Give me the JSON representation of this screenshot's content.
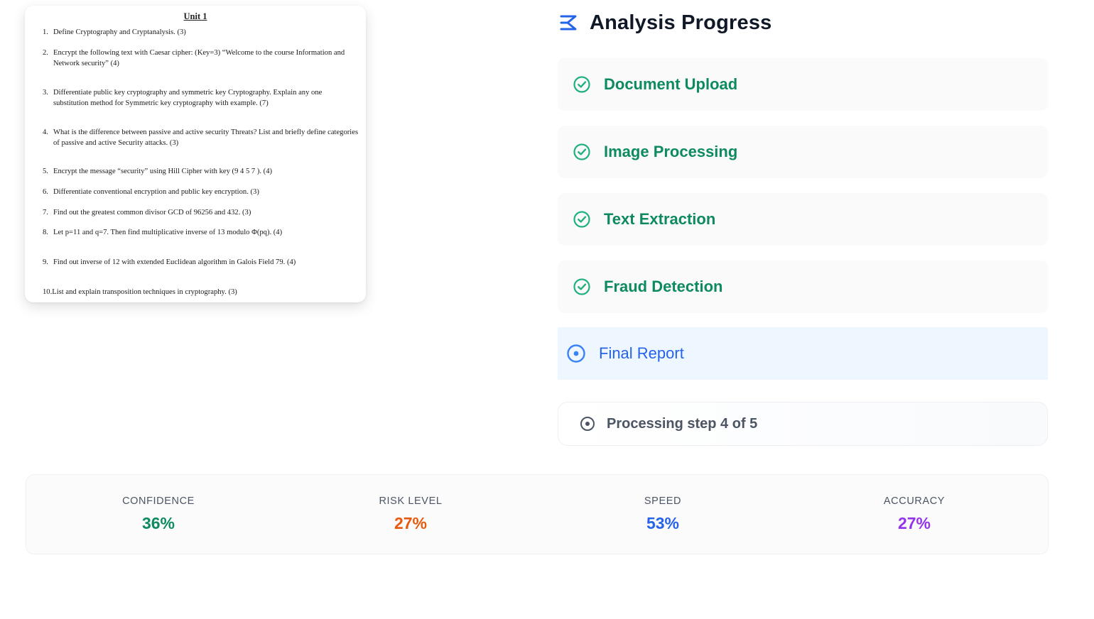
{
  "document": {
    "title": "Unit 1",
    "questions": [
      {
        "num": "1.",
        "text": "Define Cryptography and Cryptanalysis. (3)"
      },
      {
        "num": "2.",
        "text": "Encrypt the following text with Caesar cipher: (Key=3) “Welcome to the course Information and Network security” (4)"
      },
      {
        "num": "3.",
        "text": "Differentiate public key cryptography and symmetric key Cryptography. Explain any one substitution method for Symmetric key cryptography with example. (7)"
      },
      {
        "num": "4.",
        "text": "What is the difference between passive and active security Threats? List and briefly define categories of passive and active Security attacks. (3)"
      },
      {
        "num": "5.",
        "text": "Encrypt the message “security” using Hill Cipher with key (9 4 5 7 ). (4)"
      },
      {
        "num": "6.",
        "text": "Differentiate conventional encryption and public key encryption. (3)"
      },
      {
        "num": "7.",
        "text": "Find out the greatest common divisor GCD of 96256 and 432. (3)"
      },
      {
        "num": "8.",
        "text": "Let p=11 and q=7. Then find multiplicative inverse of 13 modulo Φ(pq). (4)"
      },
      {
        "num": "9.",
        "text": "Find out inverse of 12 with extended Euclidean algorithm in Galois Field 79. (4)"
      },
      {
        "num": "10.",
        "text": "List and explain transposition techniques in cryptography. (3)"
      }
    ]
  },
  "progress": {
    "title": "Analysis Progress",
    "icon": "sigma-icon",
    "steps": [
      {
        "label": "Document Upload",
        "status": "complete",
        "icon": "check-circle-icon"
      },
      {
        "label": "Image Processing",
        "status": "complete",
        "icon": "check-circle-icon"
      },
      {
        "label": "Text Extraction",
        "status": "complete",
        "icon": "check-circle-icon"
      },
      {
        "label": "Fraud Detection",
        "status": "complete",
        "icon": "check-circle-icon"
      },
      {
        "label": "Final Report",
        "status": "active",
        "icon": "target-circle-icon"
      }
    ],
    "status_text": "Processing step 4 of 5"
  },
  "metrics": [
    {
      "label": "CONFIDENCE",
      "value": "36%",
      "color": "#0e8a5f"
    },
    {
      "label": "RISK LEVEL",
      "value": "27%",
      "color": "#ea580c"
    },
    {
      "label": "SPEED",
      "value": "53%",
      "color": "#2563eb"
    },
    {
      "label": "ACCURACY",
      "value": "27%",
      "color": "#9333ea"
    }
  ],
  "colors": {
    "complete": "#0e8a5f",
    "complete_icon": "#22b07d",
    "active": "#2563eb",
    "active_bg": "#eef6ff"
  }
}
